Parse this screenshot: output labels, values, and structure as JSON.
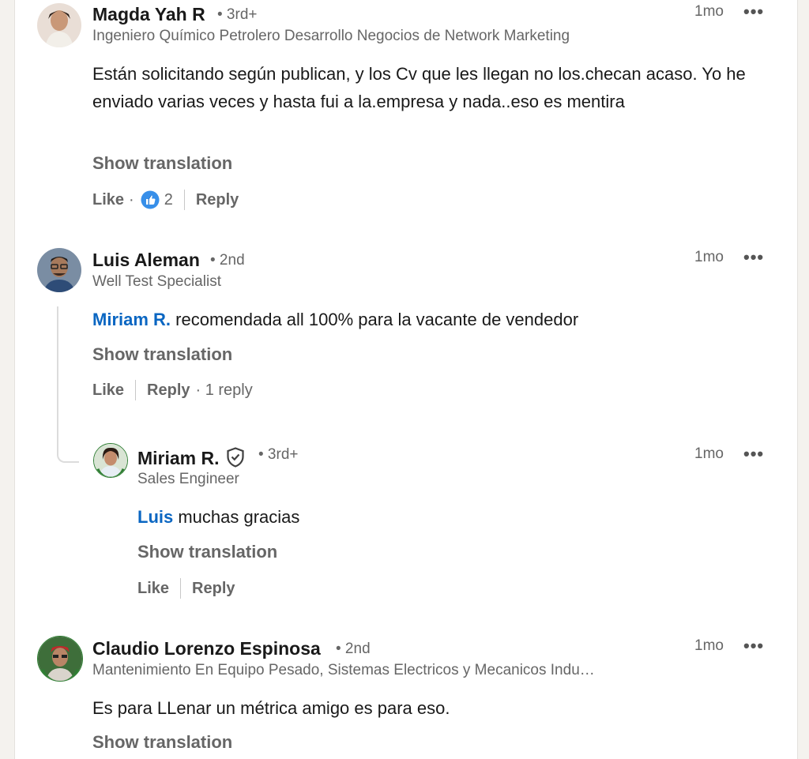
{
  "comments": [
    {
      "name": "Magda Yah R",
      "degree": "• 3rd+",
      "headline": "Ingeniero Químico Petrolero Desarrollo Negocios de Network Marketing",
      "time": "1mo",
      "text": "Están solicitando según publican, y los Cv que les llegan no los.checan acaso. Yo he enviado varias veces y hasta fui a la.empresa y nada..eso es mentira",
      "show_translation": "Show translation",
      "like_label": "Like",
      "dot": "·",
      "reaction_count": "2",
      "reply_label": "Reply"
    },
    {
      "name": "Luis Aleman",
      "degree": "• 2nd",
      "headline": "Well Test Specialist",
      "time": "1mo",
      "mention": "Miriam R.",
      "text": " recomendada all 100% para la vacante de vendedor",
      "show_translation": "Show translation",
      "like_label": "Like",
      "reply_label": "Reply",
      "replies_label": "· 1 reply"
    },
    {
      "name": "Miriam R.",
      "degree": "• 3rd+",
      "headline": "Sales Engineer",
      "time": "1mo",
      "mention": "Luis",
      "text": " muchas gracias",
      "show_translation": "Show translation",
      "like_label": "Like",
      "reply_label": "Reply"
    },
    {
      "name": "Claudio Lorenzo Espinosa",
      "degree": "• 2nd",
      "headline": "Mantenimiento En Equipo Pesado, Sistemas Electricos y Mecanicos Indu…",
      "time": "1mo",
      "text": "Es para LLenar un métrica amigo es para eso.",
      "show_translation": "Show translation"
    }
  ],
  "more_glyph": "•••",
  "colors": {
    "link": "#0a66c2",
    "muted": "#666666",
    "badge_green": "#2e7d32"
  },
  "icons": [
    "like-reaction-icon",
    "verified-shield-icon",
    "more-options-icon"
  ]
}
